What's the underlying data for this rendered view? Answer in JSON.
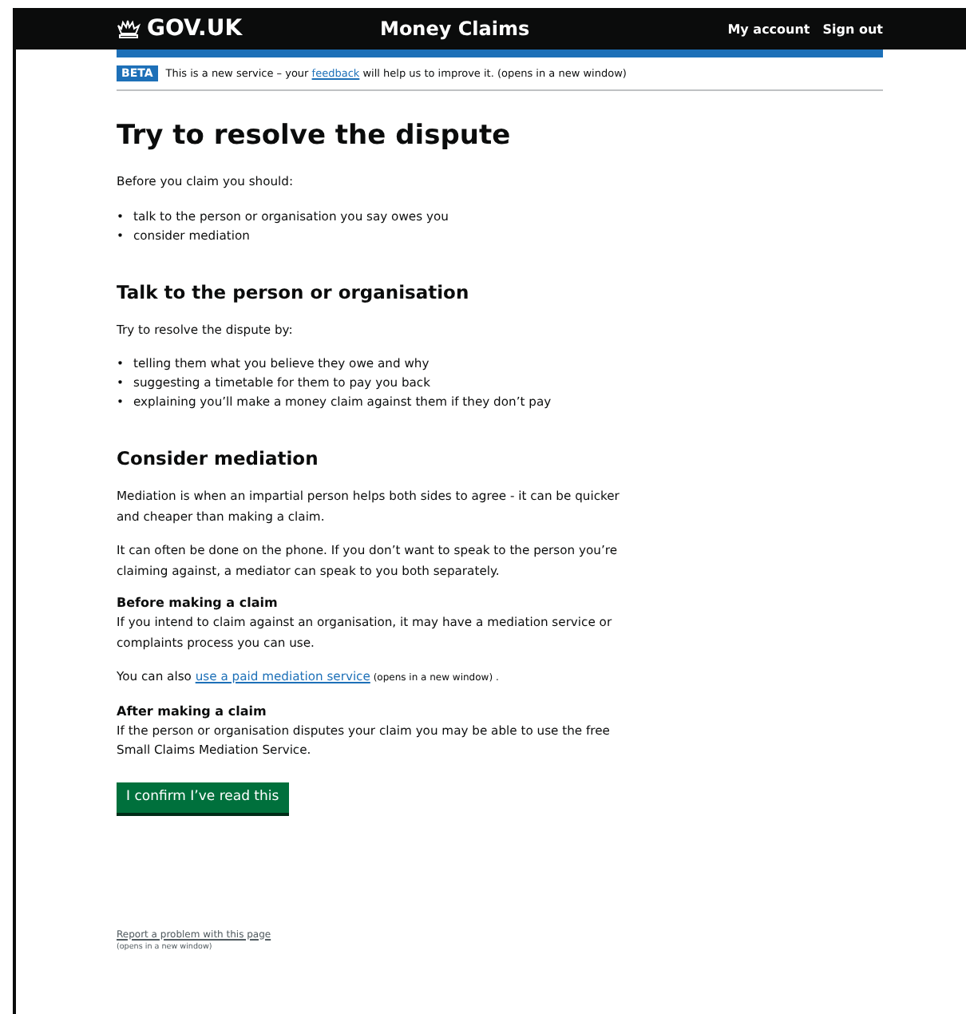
{
  "header": {
    "logo": "GOV.UK",
    "service": "Money Claims",
    "nav": [
      "My account",
      "Sign out"
    ]
  },
  "phase_banner": {
    "tag": "BETA",
    "before": "This is a new service – your ",
    "link": "feedback",
    "after": " will help us to improve it. (opens in a new window)"
  },
  "content": [
    {
      "kind": "heading1",
      "text": "Try to resolve the dispute"
    },
    {
      "kind": "paragraph",
      "text": "Before you claim you should:"
    },
    {
      "kind": "list",
      "bullet": "•",
      "items": [
        "talk to the person or organisation you say owes you",
        "consider mediation"
      ]
    },
    {
      "kind": "heading2",
      "text": "Talk to the person or organisation"
    },
    {
      "kind": "paragraph",
      "text": "Try to resolve the dispute by:"
    },
    {
      "kind": "list",
      "bullet": "•",
      "items": [
        "telling them what you believe they owe and why",
        "suggesting a timetable for them to pay you back",
        "explaining you’ll make a money claim against them if they don’t pay"
      ]
    },
    {
      "kind": "heading2",
      "text": "Consider mediation"
    },
    {
      "kind": "paragraph",
      "text": "Mediation is when an impartial person helps both sides to agree - it can be quicker and cheaper than making a claim."
    },
    {
      "kind": "paragraph",
      "text": "It can often be done on the phone. If you don’t want to speak to the person you’re claiming against, a mediator can speak to you both separately."
    },
    {
      "kind": "heading3",
      "text": "Before making a claim"
    },
    {
      "kind": "paragraph",
      "text": "If you intend to claim against an organisation, it may have a mediation service or complaints process you can use."
    },
    {
      "kind": "link_paragraph",
      "before": "You can also ",
      "link": "use a paid mediation service",
      "note": " (opens in a new window) ."
    },
    {
      "kind": "heading3",
      "text": "After making a claim"
    },
    {
      "kind": "paragraph",
      "text": "If the person or organisation disputes your claim you may be able to use the free Small Claims Mediation Service."
    },
    {
      "kind": "button",
      "text": "I confirm I’ve read this"
    }
  ],
  "footer": {
    "link": "Report a problem with this page",
    "note": "(opens in a new window)"
  }
}
